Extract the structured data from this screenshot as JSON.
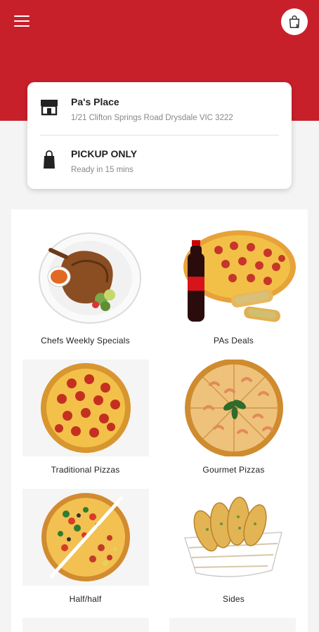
{
  "header": {
    "menu_icon": "hamburger-menu-icon",
    "cart_icon": "shopping-bag-cart-icon",
    "color": "#c8202b"
  },
  "store": {
    "name": "Pa's Place",
    "address": "1/21 Clifton Springs Road Drysdale VIC 3222",
    "icon": "storefront-icon"
  },
  "order": {
    "mode": "PICKUP ONLY",
    "ready_text": "Ready in 15 mins",
    "icon": "shopping-bag-icon"
  },
  "categories": [
    {
      "label": "Chefs Weekly Specials",
      "icon": "steak-plate-image"
    },
    {
      "label": "PAs Deals",
      "icon": "pizza-cola-deal-image"
    },
    {
      "label": "Traditional Pizzas",
      "icon": "pepperoni-pizza-image"
    },
    {
      "label": "Gourmet Pizzas",
      "icon": "gourmet-pizza-image"
    },
    {
      "label": "Half/half",
      "icon": "half-half-pizza-image"
    },
    {
      "label": "Sides",
      "icon": "garlic-bread-basket-image"
    }
  ]
}
